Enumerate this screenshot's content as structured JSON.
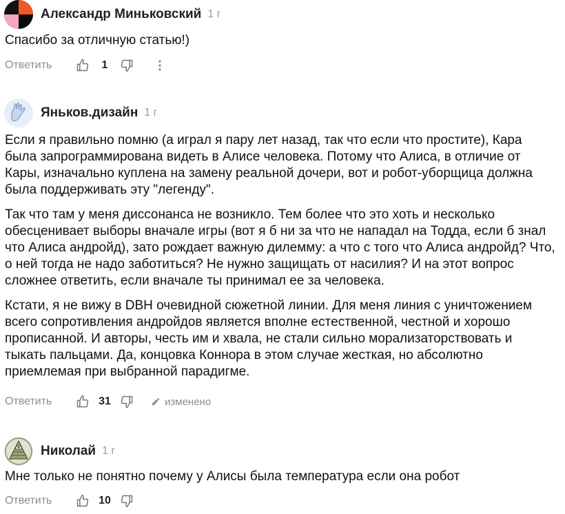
{
  "comments": [
    {
      "author": "Александр Миньковский",
      "age": "1 г",
      "paragraphs": [
        "Спасибо за отличную статью!)"
      ],
      "reply_label": "Ответить",
      "likes": "1"
    },
    {
      "author": "Яньков.дизайн",
      "age": "1 г",
      "paragraphs": [
        "Если я правильно помню (а играл я пару лет назад, так что если что простите), Кара была запрограммирована видеть в Алисе человека. Потому что Алиса, в отличие от Кары, изначально куплена на замену реальной дочери, вот и робот-уборщица должна была поддерживать эту \"легенду\".",
        "Так что там у меня диссонанса не возникло. Тем более что это хоть и несколько обесценивает выборы вначале игры (вот я б ни за что не нападал на Тодда, если б знал что Алиса андройд), зато рождает важную дилемму: а что с того что Алиса андройд? Что, о ней тогда не надо заботиться? Не нужно защищать от насилия? И на этот вопрос сложнее ответить, если вначале ты принимал ее за человека.",
        "Кстати, я не вижу в DBH очевидной сюжетной линии. Для меня линия с уничтожением всего сопротивления андройдов является вполне естественной, честной и хорошо прописанной. И авторы, честь им и хвала, не стали сильно морализаторствовать и тыкать пальцами. Да, концовка Коннора в этом случае жесткая, но абсолютно приемлемая при выбранной парадигме."
      ],
      "reply_label": "Ответить",
      "likes": "31",
      "edited_label": "изменено"
    },
    {
      "author": "Николай",
      "age": "1 г",
      "paragraphs": [
        "Мне только не понятно почему у Алисы была температура если она робот"
      ],
      "reply_label": "Ответить",
      "likes": "10"
    }
  ],
  "icons": {
    "like": "thumbs-up-icon",
    "dislike": "thumbs-down-icon",
    "more": "more-vertical-icon",
    "edit": "pencil-icon"
  },
  "colors": {
    "muted_text": "#8c8c8c",
    "text": "#111111",
    "avatar1_orange": "#f05a23",
    "avatar1_pink": "#f4a7c3"
  }
}
